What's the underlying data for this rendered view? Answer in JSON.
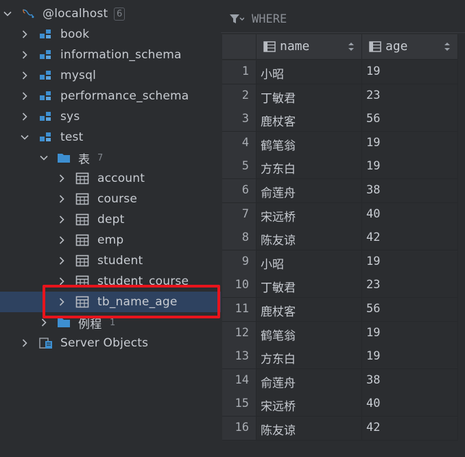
{
  "tree": {
    "connection": {
      "label": "@localhost",
      "count": "6"
    },
    "databases": [
      "book",
      "information_schema",
      "mysql",
      "performance_schema",
      "sys",
      "test"
    ],
    "tables_folder": {
      "label": "表",
      "count": "7"
    },
    "tables": [
      "account",
      "course",
      "dept",
      "emp",
      "student",
      "student_course",
      "tb_name_age"
    ],
    "routines_folder": {
      "label": "例程",
      "count": "1"
    },
    "server_objects": "Server Objects"
  },
  "grid": {
    "where_label": "WHERE",
    "columns": [
      "name",
      "age"
    ],
    "rows": [
      {
        "n": "1",
        "name": "小昭",
        "age": "19"
      },
      {
        "n": "2",
        "name": "丁敏君",
        "age": "23"
      },
      {
        "n": "3",
        "name": "鹿杖客",
        "age": "56"
      },
      {
        "n": "4",
        "name": "鹤笔翁",
        "age": "19"
      },
      {
        "n": "5",
        "name": "方东白",
        "age": "19"
      },
      {
        "n": "6",
        "name": "俞莲舟",
        "age": "38"
      },
      {
        "n": "7",
        "name": "宋远桥",
        "age": "40"
      },
      {
        "n": "8",
        "name": "陈友谅",
        "age": "42"
      },
      {
        "n": "9",
        "name": "小昭",
        "age": "19"
      },
      {
        "n": "10",
        "name": "丁敏君",
        "age": "23"
      },
      {
        "n": "11",
        "name": "鹿杖客",
        "age": "56"
      },
      {
        "n": "12",
        "name": "鹤笔翁",
        "age": "19"
      },
      {
        "n": "13",
        "name": "方东白",
        "age": "19"
      },
      {
        "n": "14",
        "name": "俞莲舟",
        "age": "38"
      },
      {
        "n": "15",
        "name": "宋远桥",
        "age": "40"
      },
      {
        "n": "16",
        "name": "陈友谅",
        "age": "42"
      }
    ]
  },
  "colors": {
    "selection": "#2e4260",
    "highlight_box": "#e8141c",
    "db_icon": "#3d8fd1",
    "folder_icon": "#3d8fd1"
  }
}
